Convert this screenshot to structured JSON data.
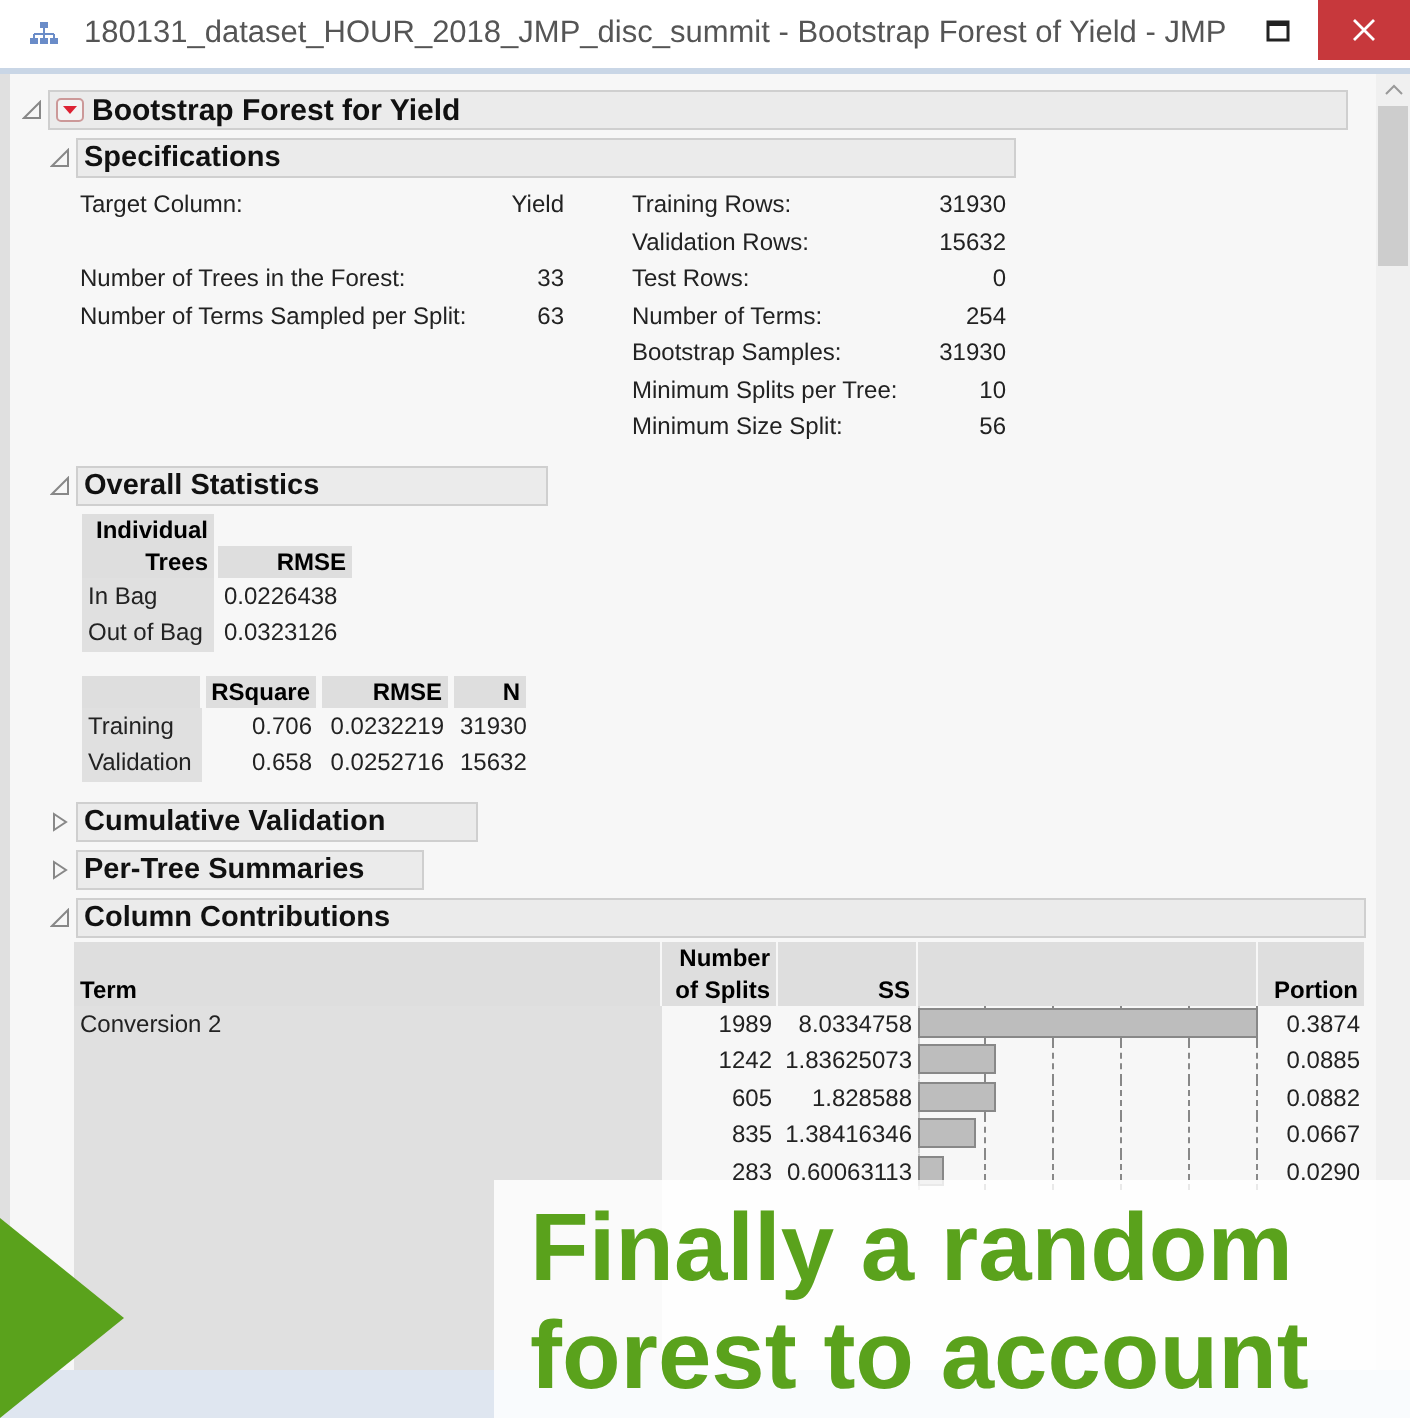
{
  "window": {
    "title": "180131_dataset_HOUR_2018_JMP_disc_summit - Bootstrap Forest of Yield - JMP"
  },
  "report": {
    "title": "Bootstrap Forest for Yield",
    "expanded": true,
    "sections": [
      {
        "kind": "specs",
        "title": "Specifications",
        "expanded": true,
        "left_groups": [
          [
            {
              "label": "Target Column:",
              "value": "Yield"
            }
          ],
          [
            {
              "label": "Number of Trees in the Forest:",
              "value": "33"
            },
            {
              "label": "Number of Terms Sampled per Split:",
              "value": "63"
            }
          ]
        ],
        "right": [
          {
            "label": "Training Rows:",
            "value": "31930"
          },
          {
            "label": "Validation Rows:",
            "value": "15632"
          },
          {
            "label": "Test Rows:",
            "value": "0"
          },
          {
            "label": "Number of Terms:",
            "value": "254"
          },
          {
            "label": "Bootstrap Samples:",
            "value": "31930"
          },
          {
            "label": "Minimum Splits per Tree:",
            "value": "10"
          },
          {
            "label": "Minimum Size Split:",
            "value": "56"
          }
        ]
      },
      {
        "kind": "stats",
        "title": "Overall Statistics",
        "expanded": true,
        "trees_table": {
          "columns": [
            "Individual Trees",
            "RMSE"
          ],
          "rows": [
            [
              "In Bag",
              "0.0226438"
            ],
            [
              "Out of Bag",
              "0.0323126"
            ]
          ]
        },
        "fit_table": {
          "columns": [
            "",
            "RSquare",
            "RMSE",
            "N"
          ],
          "rows": [
            [
              "Training",
              "0.706",
              "0.0232219",
              "31930"
            ],
            [
              "Validation",
              "0.658",
              "0.0252716",
              "15632"
            ]
          ]
        }
      },
      {
        "kind": "plain",
        "title": "Cumulative Validation",
        "expanded": false
      },
      {
        "kind": "plain",
        "title": "Per-Tree Summaries",
        "expanded": false
      },
      {
        "kind": "contributions",
        "title": "Column Contributions",
        "expanded": true,
        "columns": [
          "Term",
          "Number of Splits",
          "SS",
          "Portion"
        ],
        "rows": [
          {
            "term": "Conversion 2",
            "splits": "1989",
            "ss": "8.0334758",
            "level": 1,
            "portion": "0.3874"
          },
          {
            "splits": "1242",
            "ss": "1.83625073",
            "level": 0.228,
            "portion": "0.0885"
          },
          {
            "splits": "605",
            "ss": "1.828588",
            "level": 0.228,
            "portion": "0.0882"
          },
          {
            "splits": "835",
            "ss": "1.38416346",
            "level": 0.172,
            "portion": "0.0667"
          },
          {
            "splits": "283",
            "ss": "0.60063113",
            "level": 0.075,
            "portion": "0.0290"
          }
        ]
      }
    ]
  },
  "caption": {
    "text": "Finally a random forest to account"
  }
}
